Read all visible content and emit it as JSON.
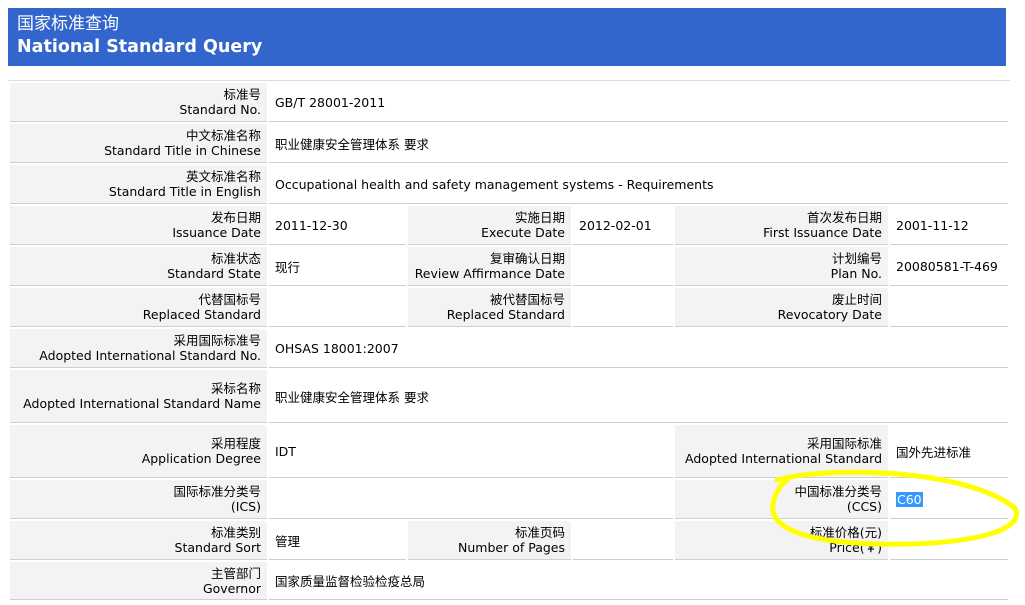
{
  "header": {
    "title_cn": "国家标准查询",
    "title_en": "National Standard Query"
  },
  "rows": {
    "standard_no": {
      "label_cn": "标准号",
      "label_en": "Standard No.",
      "value": "GB/T 28001-2011"
    },
    "title_chinese": {
      "label_cn": "中文标准名称",
      "label_en": "Standard Title in Chinese",
      "value": "职业健康安全管理体系 要求"
    },
    "title_english": {
      "label_cn": "英文标准名称",
      "label_en": "Standard Title in English",
      "value": "Occupational health and safety management systems - Requirements"
    },
    "issuance_date": {
      "label_cn": "发布日期",
      "label_en": "Issuance Date",
      "value": "2011-12-30"
    },
    "execute_date": {
      "label_cn": "实施日期",
      "label_en": "Execute Date",
      "value": "2012-02-01"
    },
    "first_issuance_date": {
      "label_cn": "首次发布日期",
      "label_en": "First Issuance Date",
      "value": "2001-11-12"
    },
    "standard_state": {
      "label_cn": "标准状态",
      "label_en": "Standard State",
      "value": "现行"
    },
    "review_affirmance_date": {
      "label_cn": "复审确认日期",
      "label_en": "Review Affirmance Date",
      "value": ""
    },
    "plan_no": {
      "label_cn": "计划编号",
      "label_en": "Plan No.",
      "value": "20080581-T-469"
    },
    "replaced_standard": {
      "label_cn": "代替国标号",
      "label_en": "Replaced Standard",
      "value": ""
    },
    "replaced_by_standard": {
      "label_cn": "被代替国标号",
      "label_en": "Replaced Standard",
      "value": ""
    },
    "revocatory_date": {
      "label_cn": "废止时间",
      "label_en": "Revocatory Date",
      "value": ""
    },
    "adopted_intl_no": {
      "label_cn": "采用国际标准号",
      "label_en": "Adopted International Standard No.",
      "value": "OHSAS 18001:2007"
    },
    "adopted_intl_name": {
      "label_cn": "采标名称",
      "label_en": "Adopted International Standard Name",
      "value": "职业健康安全管理体系 要求"
    },
    "application_degree": {
      "label_cn": "采用程度",
      "label_en": "Application Degree",
      "value": "IDT"
    },
    "adopted_intl_standard": {
      "label_cn": "采用国际标准",
      "label_en": "Adopted International Standard",
      "value": "国外先进标准"
    },
    "ics": {
      "label_cn": "国际标准分类号",
      "label_en": "(ICS)",
      "value": ""
    },
    "ccs": {
      "label_cn": "中国标准分类号",
      "label_en": "(CCS)",
      "value": "C60"
    },
    "standard_sort": {
      "label_cn": "标准类别",
      "label_en": "Standard Sort",
      "value": "管理"
    },
    "number_of_pages": {
      "label_cn": "标准页码",
      "label_en": "Number of Pages",
      "value": ""
    },
    "price": {
      "label_cn": "标准价格(元)",
      "label_en": "Price(￥)",
      "value": ""
    },
    "governor": {
      "label_cn": "主管部门",
      "label_en": "Governor",
      "value": "国家质量监督检验检疫总局"
    }
  },
  "annotation": {
    "color": "#ffff00"
  }
}
